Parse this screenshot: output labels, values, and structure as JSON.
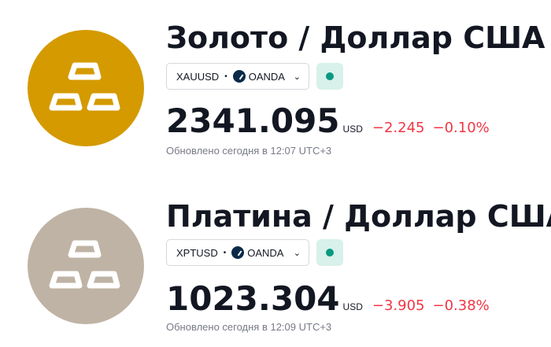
{
  "colors": {
    "gold_logo_bg": "#d49a00",
    "platinum_logo_bg": "#bfb3a5",
    "negative": "#f23645",
    "status_green": "#089981",
    "status_bg": "#d8f1ea"
  },
  "instruments": [
    {
      "title": "Золото / Доллар США",
      "symbol": "XAUUSD",
      "exchange": "OANDA",
      "exchange_icon": "oanda-logo-icon",
      "price": "2341.095",
      "currency": "USD",
      "change": "−2.245",
      "change_percent": "−0.10%",
      "updated": "Обновлено сегодня в 12:07 UTC+3",
      "market_status": "open"
    },
    {
      "title": "Платина / Доллар США",
      "symbol": "XPTUSD",
      "exchange": "OANDA",
      "exchange_icon": "oanda-logo-icon",
      "price": "1023.304",
      "currency": "USD",
      "change": "−3.905",
      "change_percent": "−0.38%",
      "updated": "Обновлено сегодня в 12:09 UTC+3",
      "market_status": "open"
    }
  ]
}
